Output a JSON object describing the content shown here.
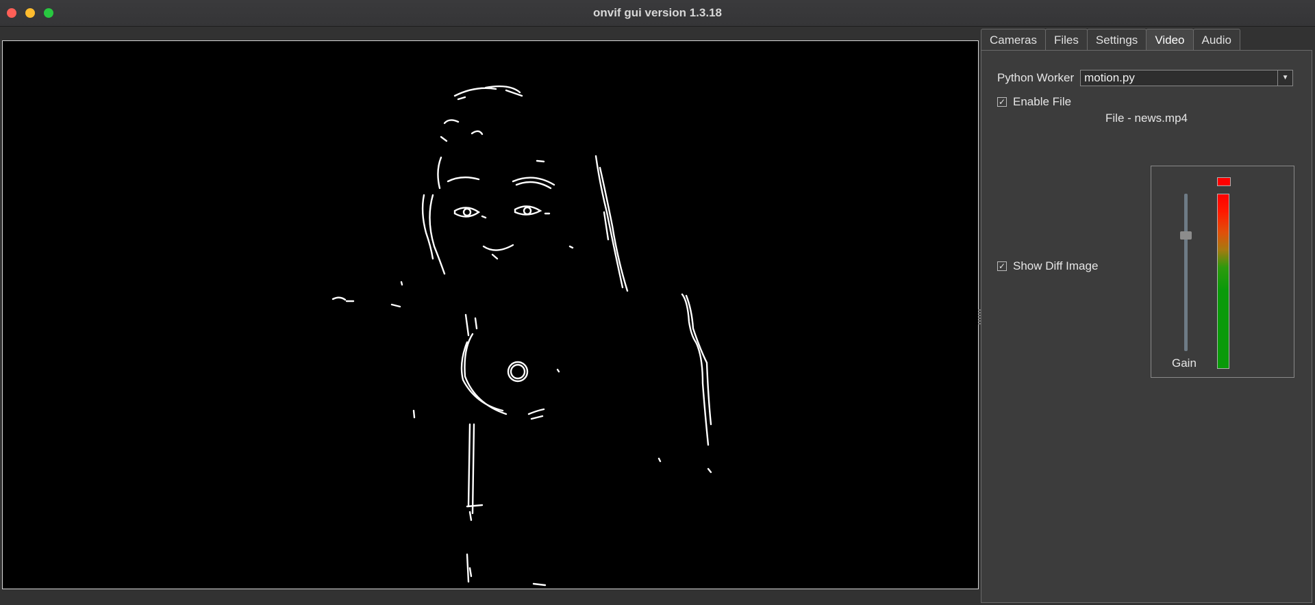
{
  "window": {
    "title": "onvif gui version 1.3.18"
  },
  "tabs": [
    {
      "label": "Cameras",
      "active": false
    },
    {
      "label": "Files",
      "active": false
    },
    {
      "label": "Settings",
      "active": false
    },
    {
      "label": "Video",
      "active": true
    },
    {
      "label": "Audio",
      "active": false
    }
  ],
  "video_panel": {
    "python_worker_label": "Python Worker",
    "python_worker_value": "motion.py",
    "enable_file_label": "Enable File",
    "enable_file_checked": true,
    "file_label": "File - news.mp4",
    "show_diff_label": "Show Diff Image",
    "show_diff_checked": true,
    "gain_label": "Gain",
    "gain_level_fraction": 0.73,
    "meter_level_fraction": 1.0
  },
  "colors": {
    "meter_top": "#ff0000",
    "meter_bottom": "#0a9a0a",
    "active_tab_bg": "#474747"
  },
  "icons": {
    "combo": "chevron-down-icon",
    "checkbox": "check-icon"
  }
}
